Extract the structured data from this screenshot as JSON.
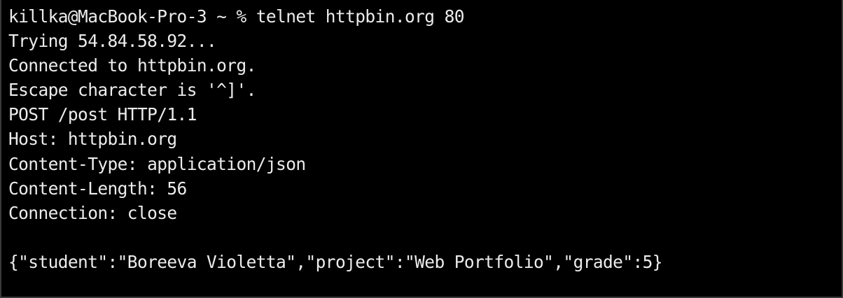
{
  "terminal": {
    "lines": [
      "killka@MacBook-Pro-3 ~ % telnet httpbin.org 80",
      "Trying 54.84.58.92...",
      "Connected to httpbin.org.",
      "Escape character is '^]'.",
      "POST /post HTTP/1.1",
      "Host: httpbin.org",
      "Content-Type: application/json",
      "Content-Length: 56",
      "Connection: close",
      "",
      "{\"student\":\"Boreeva Violetta\",\"project\":\"Web Portfolio\",\"grade\":5}"
    ],
    "colors": {
      "background": "#000000",
      "text": "#ececec"
    }
  }
}
